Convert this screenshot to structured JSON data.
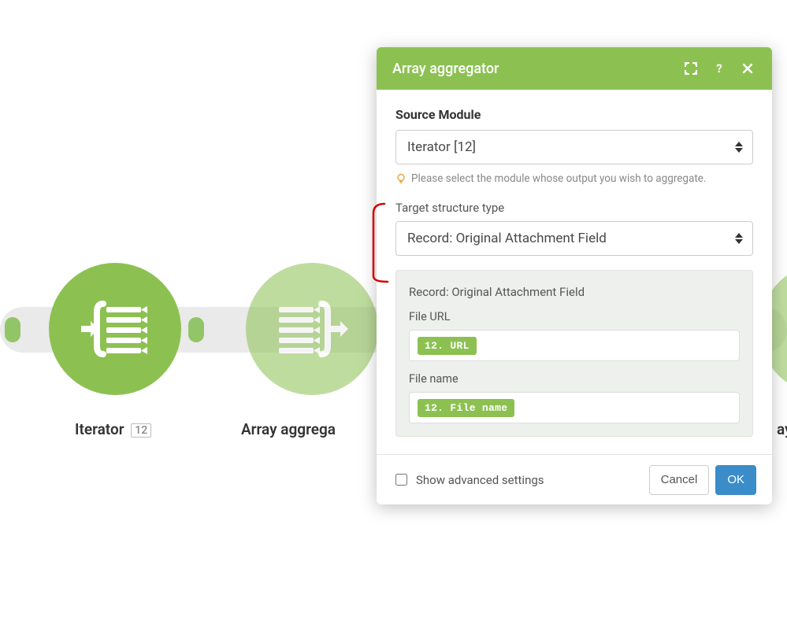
{
  "flow": {
    "node_iterator": {
      "label": "Iterator",
      "badge": "12"
    },
    "node_aggregator_left": {
      "label": "Array aggrega"
    },
    "node_aggregator_right_partial": {
      "label": "ay"
    }
  },
  "panel": {
    "title": "Array aggregator",
    "source_module": {
      "label": "Source Module",
      "value": "Iterator [12]",
      "hint": "Please select the module whose output you wish to aggregate."
    },
    "target_structure": {
      "label": "Target structure type",
      "value": "Record: Original Attachment Field"
    },
    "group": {
      "title": "Record: Original Attachment Field",
      "fields": [
        {
          "label": "File URL",
          "pill": "12. URL"
        },
        {
          "label": "File name",
          "pill": "12. File name"
        }
      ]
    },
    "footer": {
      "show_adv": "Show advanced settings",
      "cancel": "Cancel",
      "ok": "OK"
    }
  }
}
